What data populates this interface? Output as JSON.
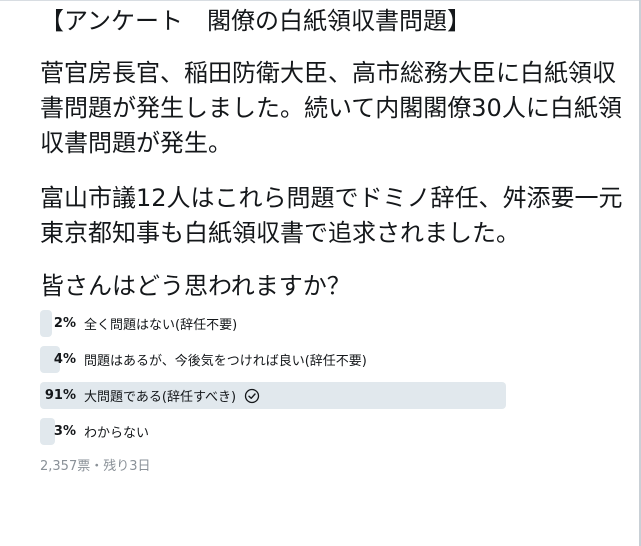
{
  "tweet": {
    "title": "【アンケート　閣僚の白紙領収書問題】",
    "paragraphs": [
      "菅官房長官、稲田防衛大臣、高市総務大臣に白紙領収書問題が発生しました。続いて内閣閣僚30人に白紙領収書問題が発生。",
      "富山市議12人はこれら問題でドミノ辞任、舛添要一元東京都知事も白紙領収書で追求されました。"
    ],
    "question": "皆さんはどう思われますか？"
  },
  "poll": {
    "options": [
      {
        "percent_label": "2%",
        "label": "全く問題はない(辞任不要)",
        "percent": 2,
        "winner": false
      },
      {
        "percent_label": "4%",
        "label": "問題はあるが、今後気をつければ良い(辞任不要)",
        "percent": 4,
        "winner": false
      },
      {
        "percent_label": "91%",
        "label": "大問題である(辞任すべき)",
        "percent": 91,
        "winner": true
      },
      {
        "percent_label": "3%",
        "label": "わからない",
        "percent": 3,
        "winner": false
      }
    ],
    "votes_label": "2,357票",
    "separator": "・",
    "remaining_label": "残り3日"
  },
  "colors": {
    "bar": "#e1e8ed",
    "text": "#14171a",
    "meta": "#8a9198"
  },
  "icons": {
    "selected": "check-circle-icon"
  }
}
